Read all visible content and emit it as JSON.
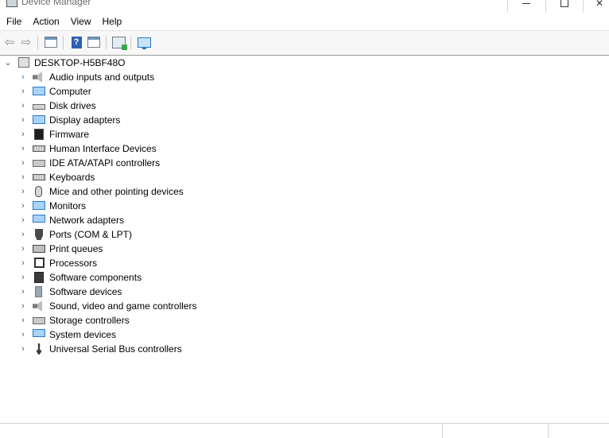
{
  "window": {
    "title": "Device Manager",
    "controls": {
      "minimize": "minimize",
      "maximize": "maximize",
      "close": "close"
    }
  },
  "menu": [
    "File",
    "Action",
    "View",
    "Help"
  ],
  "toolbar": {
    "buttons": [
      "back-icon",
      "forward-icon",
      "properties-icon",
      "help-icon",
      "view-icon",
      "scan-hardware-icon",
      "monitor-icon"
    ]
  },
  "tree": {
    "root": {
      "label": "DESKTOP-H5BF48O",
      "expanded": true
    },
    "items": [
      {
        "label": "Audio inputs and outputs",
        "icon": "speaker-icon"
      },
      {
        "label": "Computer",
        "icon": "computer-icon"
      },
      {
        "label": "Disk drives",
        "icon": "disk-drive-icon"
      },
      {
        "label": "Display adapters",
        "icon": "display-adapter-icon"
      },
      {
        "label": "Firmware",
        "icon": "firmware-chip-icon"
      },
      {
        "label": "Human Interface Devices",
        "icon": "hid-icon"
      },
      {
        "label": "IDE ATA/ATAPI controllers",
        "icon": "ide-controller-icon"
      },
      {
        "label": "Keyboards",
        "icon": "keyboard-icon"
      },
      {
        "label": "Mice and other pointing devices",
        "icon": "mouse-icon"
      },
      {
        "label": "Monitors",
        "icon": "monitor-icon"
      },
      {
        "label": "Network adapters",
        "icon": "network-adapter-icon"
      },
      {
        "label": "Ports (COM & LPT)",
        "icon": "port-icon"
      },
      {
        "label": "Print queues",
        "icon": "printer-icon"
      },
      {
        "label": "Processors",
        "icon": "processor-icon"
      },
      {
        "label": "Software components",
        "icon": "software-component-icon"
      },
      {
        "label": "Software devices",
        "icon": "software-device-icon"
      },
      {
        "label": "Sound, video and game controllers",
        "icon": "sound-controller-icon"
      },
      {
        "label": "Storage controllers",
        "icon": "storage-controller-icon"
      },
      {
        "label": "System devices",
        "icon": "system-device-icon"
      },
      {
        "label": "Universal Serial Bus controllers",
        "icon": "usb-icon"
      }
    ]
  }
}
